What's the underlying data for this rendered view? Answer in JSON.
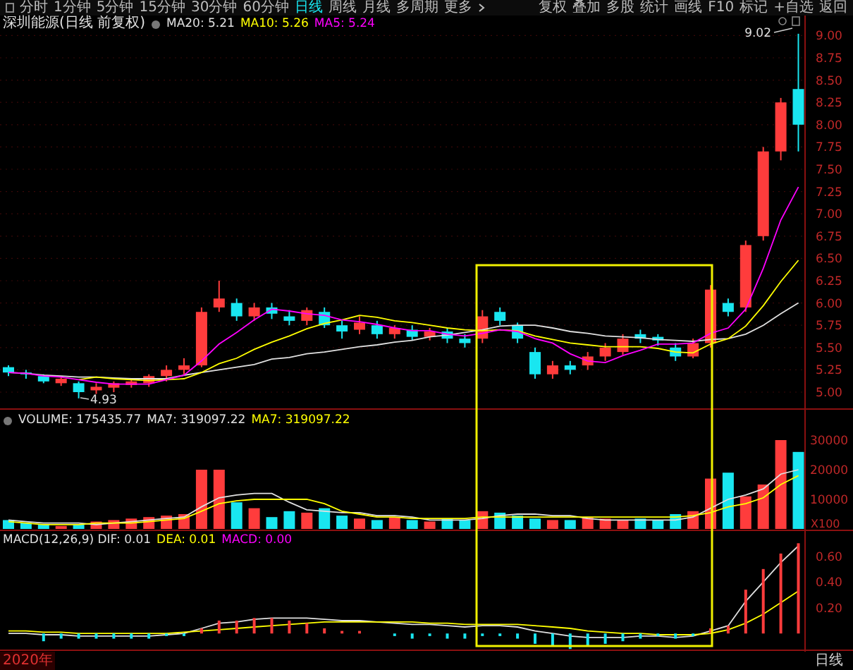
{
  "toolbar": {
    "period_tabs": [
      {
        "label": "分时",
        "selected": false
      },
      {
        "label": "1分钟",
        "selected": false
      },
      {
        "label": "5分钟",
        "selected": false
      },
      {
        "label": "15分钟",
        "selected": false
      },
      {
        "label": "30分钟",
        "selected": false
      },
      {
        "label": "60分钟",
        "selected": false
      },
      {
        "label": "日线",
        "selected": true
      },
      {
        "label": "周线",
        "selected": false
      },
      {
        "label": "月线",
        "selected": false
      },
      {
        "label": "多周期",
        "selected": false
      },
      {
        "label": "更多",
        "selected": false
      }
    ],
    "actions": [
      "复权",
      "叠加",
      "多股",
      "统计",
      "画线",
      "F10",
      "标记",
      "+自选",
      "返回"
    ]
  },
  "price_panel": {
    "title": "深圳能源(日线 前复权)",
    "high_label": "9.02",
    "low_label": "4.93",
    "chart_data": {
      "type": "candlestick",
      "grid": true,
      "categories": [
        null,
        null,
        null,
        null,
        null,
        null,
        null,
        null,
        null,
        null,
        null,
        null,
        null,
        null,
        null,
        null,
        null,
        null,
        null,
        null,
        null,
        null,
        null,
        null,
        null,
        null,
        null,
        null,
        null,
        null,
        null,
        null,
        null,
        null,
        null,
        null,
        null,
        null,
        null,
        null,
        null,
        null,
        null,
        null,
        null,
        null
      ],
      "ylim": [
        5,
        9
      ],
      "yticks": [
        {
          "value": 9,
          "label": "9.00"
        },
        {
          "value": 8.75,
          "label": "8.75"
        },
        {
          "value": 8.5,
          "label": "8.50"
        },
        {
          "value": 8.25,
          "label": "8.25"
        },
        {
          "value": 8,
          "label": "8.00"
        },
        {
          "value": 7.75,
          "label": "7.75"
        },
        {
          "value": 7.5,
          "label": "7.50"
        },
        {
          "value": 7.25,
          "label": "7.25"
        },
        {
          "value": 7,
          "label": "7.00"
        },
        {
          "value": 6.75,
          "label": "6.75"
        },
        {
          "value": 6.5,
          "label": "6.50"
        },
        {
          "value": 6.25,
          "label": "6.25"
        },
        {
          "value": 6,
          "label": "6.00"
        },
        {
          "value": 5.75,
          "label": "5.75"
        },
        {
          "value": 5.5,
          "label": "5.50"
        },
        {
          "value": 5.25,
          "label": "5.25"
        },
        {
          "value": 5,
          "label": "5.00"
        }
      ],
      "ohlc": [
        [
          5.28,
          5.3,
          5.18,
          5.22
        ],
        [
          5.22,
          5.25,
          5.15,
          5.2
        ],
        [
          5.18,
          5.2,
          5.1,
          5.12
        ],
        [
          5.1,
          5.18,
          5.07,
          5.15
        ],
        [
          5.1,
          5.12,
          4.93,
          5.0
        ],
        [
          5.02,
          5.1,
          4.98,
          5.06
        ],
        [
          5.05,
          5.12,
          5.0,
          5.1
        ],
        [
          5.08,
          5.15,
          5.05,
          5.12
        ],
        [
          5.1,
          5.2,
          5.06,
          5.18
        ],
        [
          5.18,
          5.3,
          5.12,
          5.25
        ],
        [
          5.25,
          5.38,
          5.2,
          5.3
        ],
        [
          5.3,
          5.95,
          5.28,
          5.9
        ],
        [
          5.95,
          6.25,
          5.9,
          6.05
        ],
        [
          6.0,
          6.05,
          5.8,
          5.85
        ],
        [
          5.85,
          6.0,
          5.8,
          5.95
        ],
        [
          5.95,
          6.0,
          5.82,
          5.88
        ],
        [
          5.85,
          5.92,
          5.75,
          5.8
        ],
        [
          5.8,
          5.95,
          5.75,
          5.92
        ],
        [
          5.9,
          5.95,
          5.72,
          5.75
        ],
        [
          5.75,
          5.8,
          5.6,
          5.68
        ],
        [
          5.7,
          5.85,
          5.65,
          5.78
        ],
        [
          5.75,
          5.8,
          5.6,
          5.65
        ],
        [
          5.65,
          5.75,
          5.6,
          5.72
        ],
        [
          5.7,
          5.75,
          5.58,
          5.62
        ],
        [
          5.62,
          5.72,
          5.58,
          5.68
        ],
        [
          5.68,
          5.72,
          5.55,
          5.6
        ],
        [
          5.6,
          5.65,
          5.5,
          5.55
        ],
        [
          5.6,
          5.92,
          5.55,
          5.85
        ],
        [
          5.9,
          5.95,
          5.75,
          5.8
        ],
        [
          5.75,
          5.78,
          5.55,
          5.6
        ],
        [
          5.45,
          5.5,
          5.15,
          5.2
        ],
        [
          5.2,
          5.35,
          5.15,
          5.3
        ],
        [
          5.3,
          5.35,
          5.2,
          5.25
        ],
        [
          5.3,
          5.45,
          5.25,
          5.4
        ],
        [
          5.4,
          5.55,
          5.35,
          5.5
        ],
        [
          5.45,
          5.65,
          5.42,
          5.6
        ],
        [
          5.65,
          5.7,
          5.55,
          5.6
        ],
        [
          5.62,
          5.65,
          5.52,
          5.58
        ],
        [
          5.5,
          5.55,
          5.35,
          5.4
        ],
        [
          5.4,
          5.6,
          5.38,
          5.55
        ],
        [
          5.55,
          6.2,
          5.5,
          6.15
        ],
        [
          6.0,
          6.05,
          5.85,
          5.9
        ],
        [
          5.95,
          6.7,
          5.9,
          6.65
        ],
        [
          6.75,
          7.75,
          6.7,
          7.7
        ],
        [
          7.7,
          8.3,
          7.6,
          8.25
        ],
        [
          8.4,
          9.02,
          7.7,
          8.0
        ]
      ],
      "series": [
        {
          "name": "MA20: 5.21",
          "type": "line",
          "color": "#e0e0e0",
          "values": [
            5.22,
            5.21,
            5.19,
            5.18,
            5.17,
            5.17,
            5.16,
            5.15,
            5.15,
            5.15,
            5.19,
            5.22,
            5.25,
            5.28,
            5.31,
            5.37,
            5.39,
            5.43,
            5.45,
            5.48,
            5.51,
            5.53,
            5.56,
            5.58,
            5.62,
            5.64,
            5.67,
            5.7,
            5.74,
            5.75,
            5.75,
            5.72,
            5.68,
            5.66,
            5.63,
            5.62,
            5.61,
            5.59,
            5.58,
            5.57,
            5.59,
            5.6,
            5.65,
            5.75,
            5.88,
            6.0
          ]
        },
        {
          "name": "MA10: 5.26",
          "type": "line",
          "color": "#ffff00",
          "values": [
            null,
            null,
            null,
            null,
            5.14,
            5.17,
            5.15,
            5.14,
            5.13,
            5.14,
            5.15,
            5.22,
            5.32,
            5.38,
            5.48,
            5.56,
            5.63,
            5.71,
            5.77,
            5.81,
            5.86,
            5.84,
            5.8,
            5.78,
            5.75,
            5.72,
            5.7,
            5.69,
            5.7,
            5.69,
            5.63,
            5.59,
            5.55,
            5.53,
            5.51,
            5.51,
            5.51,
            5.49,
            5.45,
            5.44,
            5.54,
            5.6,
            5.74,
            5.97,
            6.24,
            6.48
          ]
        },
        {
          "name": "MA5: 5.24",
          "type": "line",
          "color": "#ff00ff",
          "values": [
            5.22,
            5.21,
            5.18,
            5.17,
            5.14,
            5.11,
            5.09,
            5.09,
            5.09,
            5.14,
            5.19,
            5.35,
            5.54,
            5.67,
            5.81,
            5.93,
            5.91,
            5.88,
            5.86,
            5.81,
            5.79,
            5.76,
            5.72,
            5.69,
            5.69,
            5.65,
            5.63,
            5.66,
            5.7,
            5.68,
            5.6,
            5.55,
            5.43,
            5.35,
            5.33,
            5.41,
            5.47,
            5.54,
            5.54,
            5.55,
            5.66,
            5.72,
            5.93,
            6.39,
            6.93,
            7.3
          ]
        }
      ]
    }
  },
  "volume_panel": {
    "chart_data": {
      "type": "bar",
      "ylabel": "X100",
      "ylim": [
        0,
        30000
      ],
      "categories": [
        null,
        null,
        null,
        null,
        null,
        null,
        null,
        null,
        null,
        null,
        null,
        null,
        null,
        null,
        null,
        null,
        null,
        null,
        null,
        null,
        null,
        null,
        null,
        null,
        null,
        null,
        null,
        null,
        null,
        null,
        null,
        null,
        null,
        null,
        null,
        null,
        null,
        null,
        null,
        null,
        null,
        null,
        null,
        null,
        null,
        null
      ],
      "yticks": [
        {
          "value": 30000,
          "label": "30000"
        },
        {
          "value": 20000,
          "label": "20000"
        },
        {
          "value": 10000,
          "label": "10000"
        }
      ],
      "series": [
        {
          "name": "VOLUME: 175435.77",
          "values": [
            3000,
            2000,
            1500,
            1000,
            1500,
            2500,
            3000,
            3500,
            4000,
            4500,
            5000,
            20000,
            20000,
            9000,
            7000,
            4000,
            6000,
            5500,
            7000,
            4500,
            3500,
            3000,
            4000,
            3000,
            2500,
            3500,
            3000,
            6000,
            5500,
            4500,
            3500,
            3000,
            3000,
            4000,
            3500,
            3000,
            3500,
            3000,
            5000,
            6000,
            17000,
            19000,
            11000,
            15000,
            30000,
            26000
          ],
          "colors": [
            "#19e6f0",
            "#19e6f0",
            "#19e6f0",
            "#ff3c3c",
            "#19e6f0",
            "#ff3c3c",
            "#ff3c3c",
            "#ff3c3c",
            "#ff3c3c",
            "#ff3c3c",
            "#ff3c3c",
            "#ff3c3c",
            "#ff3c3c",
            "#19e6f0",
            "#ff3c3c",
            "#19e6f0",
            "#19e6f0",
            "#ff3c3c",
            "#19e6f0",
            "#19e6f0",
            "#ff3c3c",
            "#19e6f0",
            "#ff3c3c",
            "#19e6f0",
            "#ff3c3c",
            "#19e6f0",
            "#19e6f0",
            "#ff3c3c",
            "#19e6f0",
            "#19e6f0",
            "#19e6f0",
            "#ff3c3c",
            "#19e6f0",
            "#ff3c3c",
            "#ff3c3c",
            "#ff3c3c",
            "#19e6f0",
            "#19e6f0",
            "#19e6f0",
            "#ff3c3c",
            "#ff3c3c",
            "#19e6f0",
            "#ff3c3c",
            "#ff3c3c",
            "#ff3c3c",
            "#19e6f0"
          ]
        },
        {
          "name": "MA7: 319097.22",
          "type": "line",
          "color": "#e0e0e0",
          "values": [
            3000,
            2500,
            2000,
            2000,
            2000,
            1500,
            2000,
            2500,
            3000,
            3500,
            4000,
            7500,
            10500,
            11500,
            12000,
            12000,
            9000,
            6500,
            6000,
            5500,
            5500,
            4500,
            4500,
            4000,
            3000,
            3000,
            3000,
            3500,
            4500,
            5000,
            5000,
            4500,
            4500,
            3500,
            3000,
            3000,
            3000,
            3000,
            3000,
            4000,
            7000,
            10000,
            11500,
            13500,
            18500,
            20000
          ]
        },
        {
          "name": "MA7: 319097.22",
          "type": "line",
          "color": "#ffff00",
          "values": [
            2500,
            2000,
            1500,
            1500,
            1500,
            2000,
            2000,
            2000,
            2500,
            3000,
            3500,
            6000,
            8500,
            9500,
            10000,
            10000,
            10000,
            10000,
            8500,
            6000,
            5000,
            4000,
            4000,
            3500,
            3500,
            3500,
            3500,
            4000,
            4000,
            4000,
            4000,
            4000,
            4000,
            4000,
            4000,
            4000,
            4000,
            4000,
            4000,
            4500,
            5500,
            7500,
            8500,
            10500,
            15000,
            18000
          ]
        }
      ]
    }
  },
  "macd_panel": {
    "chart_data": {
      "type": "bar",
      "ylim": [
        -0.13,
        0.8
      ],
      "categories": [
        null,
        null,
        null,
        null,
        null,
        null,
        null,
        null,
        null,
        null,
        null,
        null,
        null,
        null,
        null,
        null,
        null,
        null,
        null,
        null,
        null,
        null,
        null,
        null,
        null,
        null,
        null,
        null,
        null,
        null,
        null,
        null,
        null,
        null,
        null,
        null,
        null,
        null,
        null,
        null,
        null,
        null,
        null,
        null,
        null,
        null
      ],
      "yticks": [
        {
          "value": 0.6,
          "label": "0.60"
        },
        {
          "value": 0.4,
          "label": "0.40"
        },
        {
          "value": 0.2,
          "label": "0.20"
        }
      ],
      "series": [
        {
          "name": "MACD(12,26,9) DIF: 0.01",
          "type": "line",
          "color": "#e0e0e0",
          "values": [
            0,
            0,
            -0.01,
            -0.01,
            -0.02,
            -0.02,
            -0.02,
            -0.02,
            -0.02,
            -0.01,
            0,
            0.04,
            0.08,
            0.09,
            0.11,
            0.12,
            0.12,
            0.12,
            0.11,
            0.1,
            0.1,
            0.09,
            0.08,
            0.07,
            0.07,
            0.06,
            0.05,
            0.06,
            0.06,
            0.05,
            0.02,
            0,
            -0.02,
            -0.03,
            -0.03,
            -0.03,
            -0.02,
            -0.02,
            -0.03,
            -0.02,
            0.02,
            0.06,
            0.25,
            0.4,
            0.55,
            0.68
          ]
        },
        {
          "name": "DEA: 0.01",
          "type": "line",
          "color": "#ffff00",
          "values": [
            0.02,
            0.02,
            0.01,
            0.01,
            0,
            0,
            0,
            0,
            0,
            0,
            0.01,
            0.02,
            0.03,
            0.04,
            0.05,
            0.06,
            0.07,
            0.08,
            0.09,
            0.09,
            0.09,
            0.09,
            0.09,
            0.09,
            0.08,
            0.08,
            0.07,
            0.07,
            0.07,
            0.07,
            0.06,
            0.05,
            0.04,
            0.02,
            0.01,
            0,
            0,
            -0.01,
            -0.01,
            -0.01,
            0,
            0.03,
            0.08,
            0.15,
            0.24,
            0.33
          ]
        },
        {
          "name": "MACD: 0.00",
          "values": [
            null,
            null,
            -0.06,
            -0.04,
            -0.04,
            -0.04,
            -0.04,
            -0.04,
            -0.04,
            -0.02,
            -0.02,
            0.04,
            0.1,
            0.1,
            0.12,
            0.12,
            0.1,
            0.08,
            0.04,
            0.02,
            0.02,
            null,
            -0.02,
            -0.04,
            -0.02,
            -0.04,
            -0.04,
            -0.02,
            -0.02,
            -0.04,
            -0.08,
            -0.1,
            -0.12,
            -0.1,
            -0.08,
            -0.06,
            -0.04,
            -0.02,
            -0.04,
            -0.02,
            0.04,
            0.06,
            0.34,
            0.5,
            0.62,
            0.7
          ],
          "colors": [
            null,
            null,
            "#19e6f0",
            "#19e6f0",
            "#19e6f0",
            "#19e6f0",
            "#19e6f0",
            "#19e6f0",
            "#19e6f0",
            "#19e6f0",
            "#19e6f0",
            "#ff3c3c",
            "#ff3c3c",
            "#ff3c3c",
            "#ff3c3c",
            "#ff3c3c",
            "#ff3c3c",
            "#ff3c3c",
            "#ff3c3c",
            "#ff3c3c",
            "#ff3c3c",
            null,
            "#19e6f0",
            "#19e6f0",
            "#19e6f0",
            "#19e6f0",
            "#19e6f0",
            "#19e6f0",
            "#19e6f0",
            "#19e6f0",
            "#19e6f0",
            "#19e6f0",
            "#19e6f0",
            "#19e6f0",
            "#19e6f0",
            "#19e6f0",
            "#19e6f0",
            "#19e6f0",
            "#19e6f0",
            "#19e6f0",
            "#ff3c3c",
            "#ff3c3c",
            "#ff3c3c",
            "#ff3c3c",
            "#ff3c3c",
            "#ff3c3c"
          ]
        }
      ]
    }
  },
  "status_bar": {
    "date": "2020年",
    "period": "日线"
  }
}
